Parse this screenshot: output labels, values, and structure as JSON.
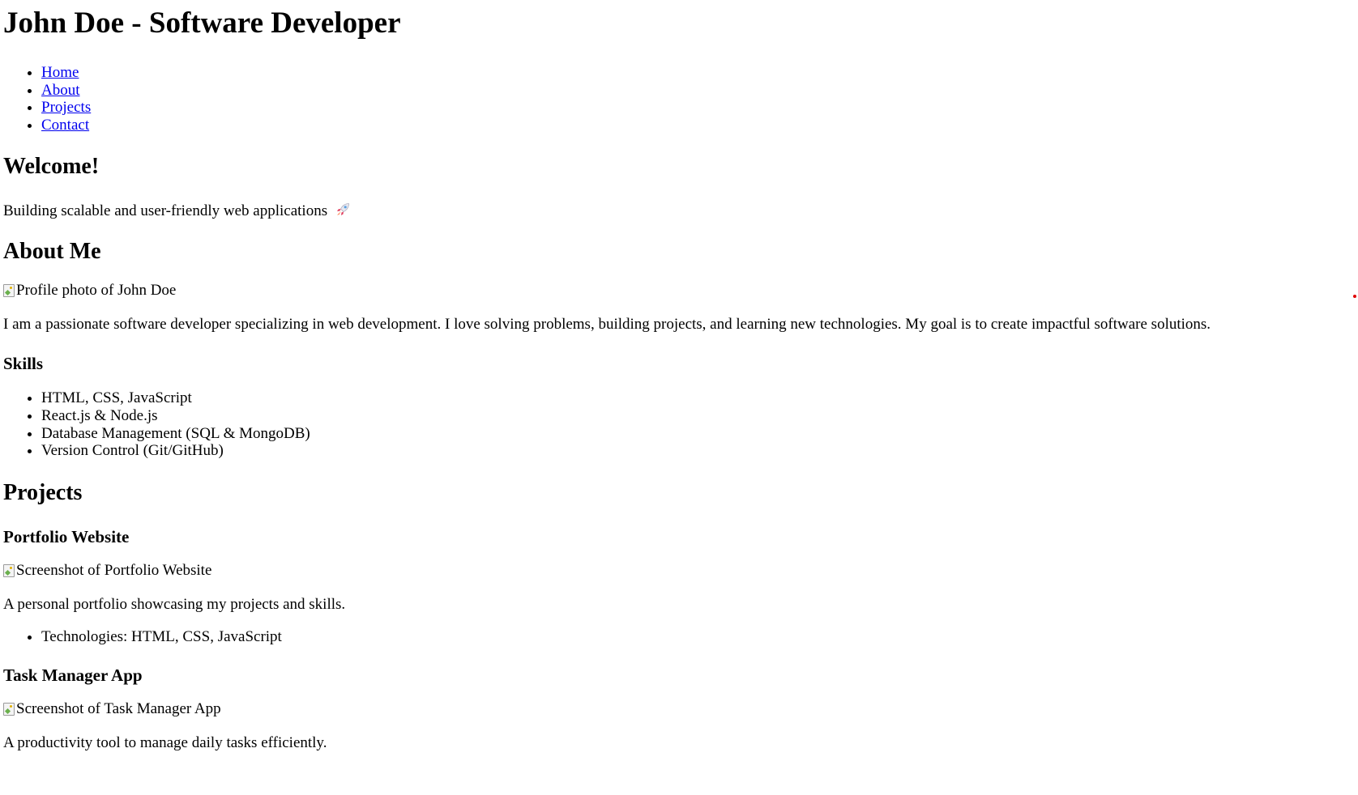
{
  "header": {
    "title": "John Doe - Software Developer"
  },
  "nav": {
    "items": [
      {
        "label": "Home"
      },
      {
        "label": "About"
      },
      {
        "label": "Projects"
      },
      {
        "label": "Contact"
      }
    ]
  },
  "welcome": {
    "heading": "Welcome!",
    "tagline": "Building scalable and user-friendly web applications",
    "tagline_icon": "rocket-icon"
  },
  "about": {
    "heading": "About Me",
    "photo_alt": "Profile photo of John Doe",
    "bio": "I am a passionate software developer specializing in web development. I love solving problems, building projects, and learning new technologies. My goal is to create impactful software solutions.",
    "skills_heading": "Skills",
    "skills": [
      "HTML, CSS, JavaScript",
      "React.js & Node.js",
      "Database Management (SQL & MongoDB)",
      "Version Control (Git/GitHub)"
    ]
  },
  "projects": {
    "heading": "Projects",
    "items": [
      {
        "title": "Portfolio Website",
        "screenshot_alt": "Screenshot of Portfolio Website",
        "description": "A personal portfolio showcasing my projects and skills.",
        "technologies": "Technologies: HTML, CSS, JavaScript"
      },
      {
        "title": "Task Manager App",
        "screenshot_alt": "Screenshot of Task Manager App",
        "description": "A productivity tool to manage daily tasks efficiently."
      }
    ]
  },
  "colors": {
    "link": "#0000ee",
    "text": "#000000",
    "background": "#ffffff",
    "stray_dot": "#e00000"
  }
}
